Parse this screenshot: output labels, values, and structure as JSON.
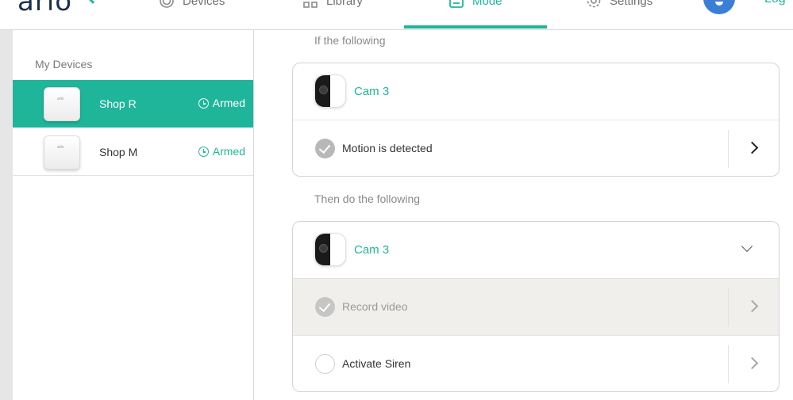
{
  "header": {
    "logo_text": "arlo",
    "nav": {
      "devices": "Devices",
      "library": "Library",
      "mode": "Mode",
      "settings": "Settings"
    },
    "active_tab": "Mode",
    "logout_label": "Log"
  },
  "sidebar": {
    "heading": "My Devices",
    "devices": [
      {
        "name": "Shop R",
        "status": "Armed",
        "selected": true
      },
      {
        "name": "Shop M",
        "status": "Armed",
        "selected": false
      }
    ]
  },
  "rule": {
    "if_label": "If the following",
    "if_card": {
      "camera_name": "Cam 3",
      "trigger_label": "Motion is detected"
    },
    "then_label": "Then do the following",
    "then_card": {
      "camera_name": "Cam 3",
      "actions": [
        {
          "label": "Record video",
          "checked": true
        },
        {
          "label": "Activate Siren",
          "checked": false
        }
      ]
    }
  },
  "colors": {
    "accent": "#1fb59a",
    "brand_text": "#1b2f4f",
    "notification": "#3a7fd5",
    "row_shade": "#f0efec"
  },
  "icons": {
    "nav_devices": "devices-icon",
    "nav_library": "library-icon",
    "nav_mode": "mode-icon",
    "nav_settings": "gear-icon",
    "status": "clock-icon",
    "notification": "bell-icon"
  }
}
